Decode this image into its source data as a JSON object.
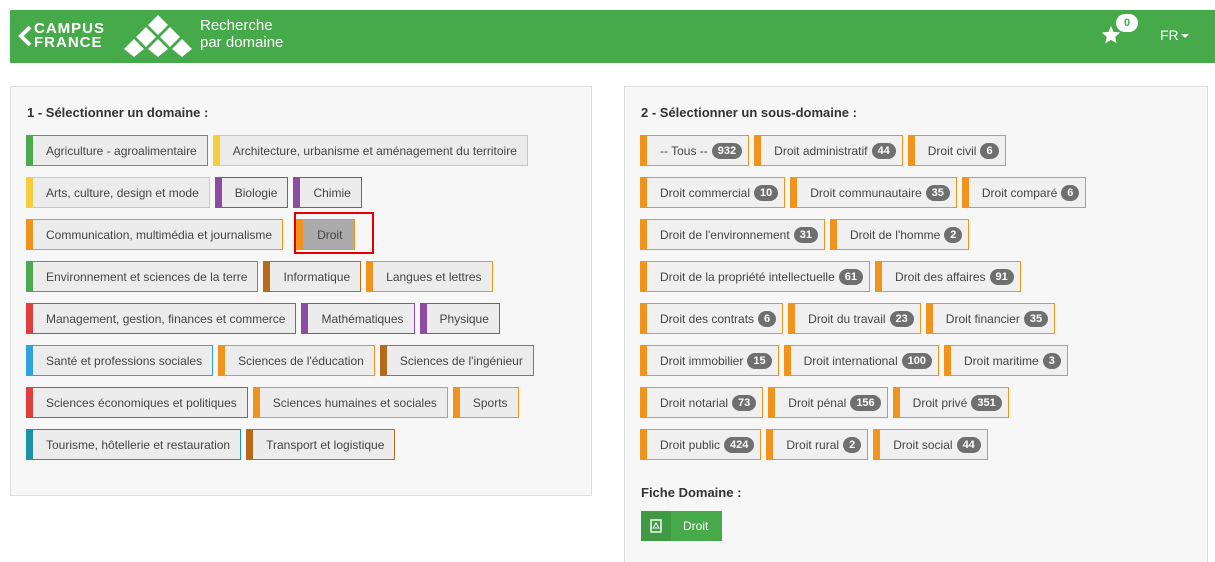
{
  "header": {
    "logo_line1": "CAMPUS",
    "logo_line2": "FRANCE",
    "title_line1": "Recherche",
    "title_line2": "par domaine",
    "fav_count": "0",
    "lang": "FR",
    "brand_color": "#46a94a"
  },
  "domains": {
    "heading": "1 - Sélectionner un domaine :",
    "items": [
      {
        "label": "Agriculture - agroalimentaire",
        "color": "green"
      },
      {
        "label": "Architecture, urbanisme et aménagement du territoire",
        "color": "yellow"
      },
      {
        "label": "Arts, culture, design et mode",
        "color": "yellow"
      },
      {
        "label": "Biologie",
        "color": "purple"
      },
      {
        "label": "Chimie",
        "color": "purple"
      },
      {
        "label": "Communication, multimédia et journalisme",
        "color": "orange"
      },
      {
        "label": "Droit",
        "color": "orange",
        "selected": true
      },
      {
        "label": "Environnement et sciences de la terre",
        "color": "green"
      },
      {
        "label": "Informatique",
        "color": "brown"
      },
      {
        "label": "Langues et lettres",
        "color": "orange"
      },
      {
        "label": "Management, gestion, finances et commerce",
        "color": "red"
      },
      {
        "label": "Mathématiques",
        "color": "purple"
      },
      {
        "label": "Physique",
        "color": "purple"
      },
      {
        "label": "Santé et professions sociales",
        "color": "blue"
      },
      {
        "label": "Sciences de l'éducation",
        "color": "orange"
      },
      {
        "label": "Sciences de l'ingénieur",
        "color": "brown"
      },
      {
        "label": "Sciences économiques et politiques",
        "color": "red"
      },
      {
        "label": "Sciences humaines et sociales",
        "color": "orange"
      },
      {
        "label": "Sports",
        "color": "orange"
      },
      {
        "label": "Tourisme, hôtellerie et restauration",
        "color": "teal"
      },
      {
        "label": "Transport et logistique",
        "color": "brown"
      }
    ]
  },
  "subdomains": {
    "heading": "2 - Sélectionner un sous-domaine :",
    "items": [
      {
        "label": "-- Tous --",
        "count": "932"
      },
      {
        "label": "Droit administratif",
        "count": "44"
      },
      {
        "label": "Droit civil",
        "count": "6"
      },
      {
        "label": "Droit commercial",
        "count": "10"
      },
      {
        "label": "Droit communautaire",
        "count": "35"
      },
      {
        "label": "Droit comparé",
        "count": "6"
      },
      {
        "label": "Droit de l'environnement",
        "count": "31"
      },
      {
        "label": "Droit de l'homme",
        "count": "2"
      },
      {
        "label": "Droit de la propriété intellectuelle",
        "count": "61"
      },
      {
        "label": "Droit des affaires",
        "count": "91"
      },
      {
        "label": "Droit des contrats",
        "count": "6"
      },
      {
        "label": "Droit du travail",
        "count": "23"
      },
      {
        "label": "Droit financier",
        "count": "35"
      },
      {
        "label": "Droit immobilier",
        "count": "15"
      },
      {
        "label": "Droit international",
        "count": "100"
      },
      {
        "label": "Droit maritime",
        "count": "3"
      },
      {
        "label": "Droit notarial",
        "count": "73"
      },
      {
        "label": "Droit pénal",
        "count": "156"
      },
      {
        "label": "Droit privé",
        "count": "351"
      },
      {
        "label": "Droit public",
        "count": "424"
      },
      {
        "label": "Droit rural",
        "count": "2"
      },
      {
        "label": "Droit social",
        "count": "44"
      }
    ]
  },
  "fiche": {
    "heading": "Fiche Domaine :",
    "button_label": "Droit",
    "icon": "pdf-icon"
  }
}
